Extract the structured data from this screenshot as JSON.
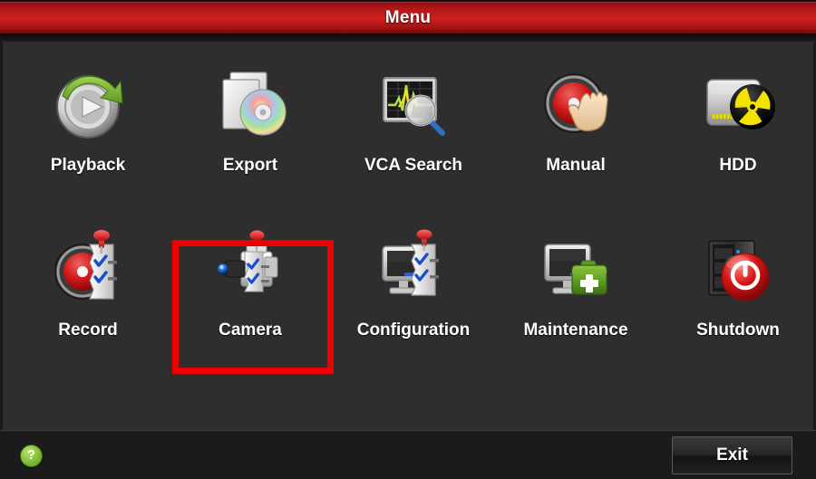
{
  "window": {
    "title": "Menu",
    "title_bar_color": "#c11c1c",
    "background_color": "#2e2e2e"
  },
  "menu": {
    "items": [
      {
        "label": "Playback",
        "icon": "playback-icon",
        "highlighted": false
      },
      {
        "label": "Export",
        "icon": "export-icon",
        "highlighted": false
      },
      {
        "label": "VCA Search",
        "icon": "vca-search-icon",
        "highlighted": false
      },
      {
        "label": "Manual",
        "icon": "manual-record-icon",
        "highlighted": false
      },
      {
        "label": "HDD",
        "icon": "hdd-icon",
        "highlighted": false
      },
      {
        "label": "Record",
        "icon": "record-icon",
        "highlighted": false
      },
      {
        "label": "Camera",
        "icon": "camera-icon",
        "highlighted": true
      },
      {
        "label": "Configuration",
        "icon": "configuration-icon",
        "highlighted": false
      },
      {
        "label": "Maintenance",
        "icon": "maintenance-icon",
        "highlighted": false
      },
      {
        "label": "Shutdown",
        "icon": "shutdown-icon",
        "highlighted": false
      }
    ],
    "highlight_color": "#f00000"
  },
  "footer": {
    "help_label": "?",
    "help_icon": "help-icon",
    "help_color": "#8cc63f",
    "exit_label": "Exit"
  }
}
